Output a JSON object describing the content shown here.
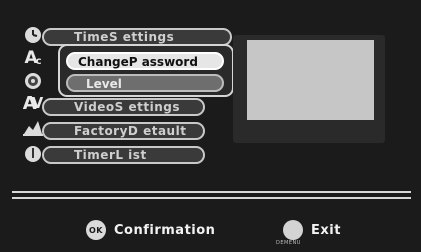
{
  "menu": {
    "items": [
      {
        "label": "TimeS ettings",
        "icon": "clock-icon"
      },
      {
        "label": "ChangeP assword",
        "icon": "password-icon"
      },
      {
        "label": "Level",
        "icon": "level-icon"
      },
      {
        "label": "VideoS ettings",
        "icon": "video-icon"
      },
      {
        "label": "FactoryD etault",
        "icon": "factory-icon"
      },
      {
        "label": "TimerL ist",
        "icon": "timer-icon"
      }
    ],
    "selected": "ChangeP assword"
  },
  "footer": {
    "ok_glyph": "OK",
    "ok_label": "Confirmation",
    "exit_label": "Exit",
    "exit_caption": "DEMENU"
  }
}
